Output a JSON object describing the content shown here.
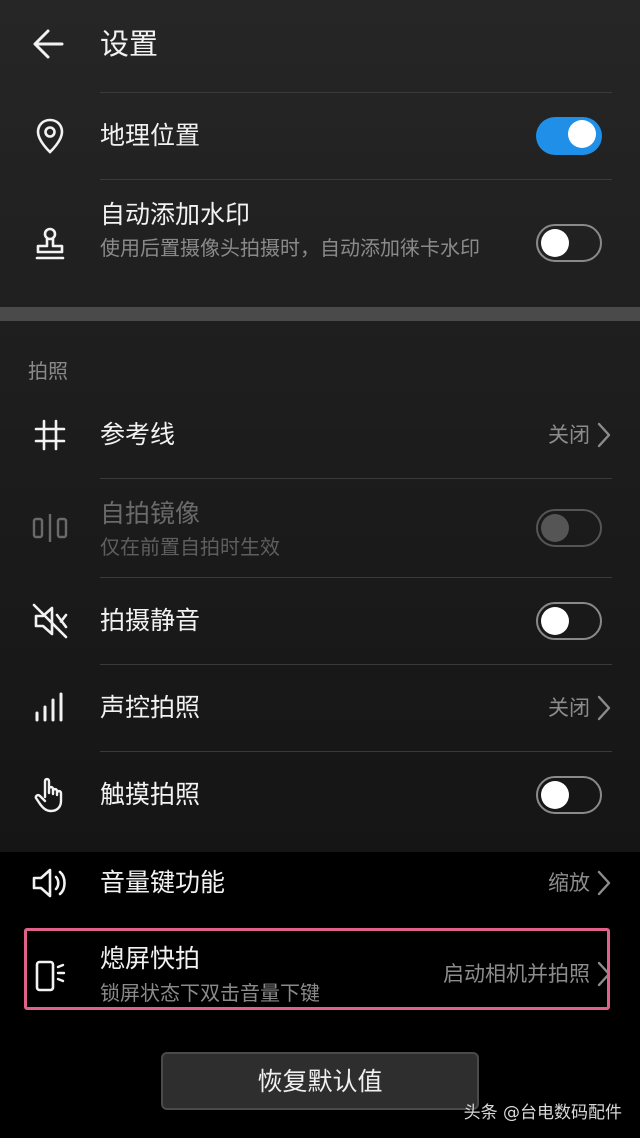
{
  "header": {
    "title": "设置"
  },
  "location": {
    "label": "地理位置",
    "enabled": true
  },
  "watermark_setting": {
    "label": "自动添加水印",
    "description": "使用后置摄像头拍摄时，自动添加徕卡水印",
    "enabled": false
  },
  "section": {
    "header": "拍照"
  },
  "grid": {
    "label": "参考线",
    "value": "关闭"
  },
  "mirror": {
    "label": "自拍镜像",
    "description": "仅在前置自拍时生效",
    "enabled": false,
    "disabled": true
  },
  "mute": {
    "label": "拍摄静音",
    "enabled": false
  },
  "voice": {
    "label": "声控拍照",
    "value": "关闭"
  },
  "touch": {
    "label": "触摸拍照",
    "enabled": false
  },
  "volume_key": {
    "label": "音量键功能",
    "value": "缩放"
  },
  "quick_snap": {
    "label": "熄屏快拍",
    "description": "锁屏状态下双击音量下键",
    "value": "启动相机并拍照"
  },
  "reset": {
    "label": "恢复默认值"
  },
  "credit": {
    "text": "头条 @台电数码配件"
  },
  "colors": {
    "accent": "#1f8fe8",
    "highlight_border": "#e0628a"
  }
}
